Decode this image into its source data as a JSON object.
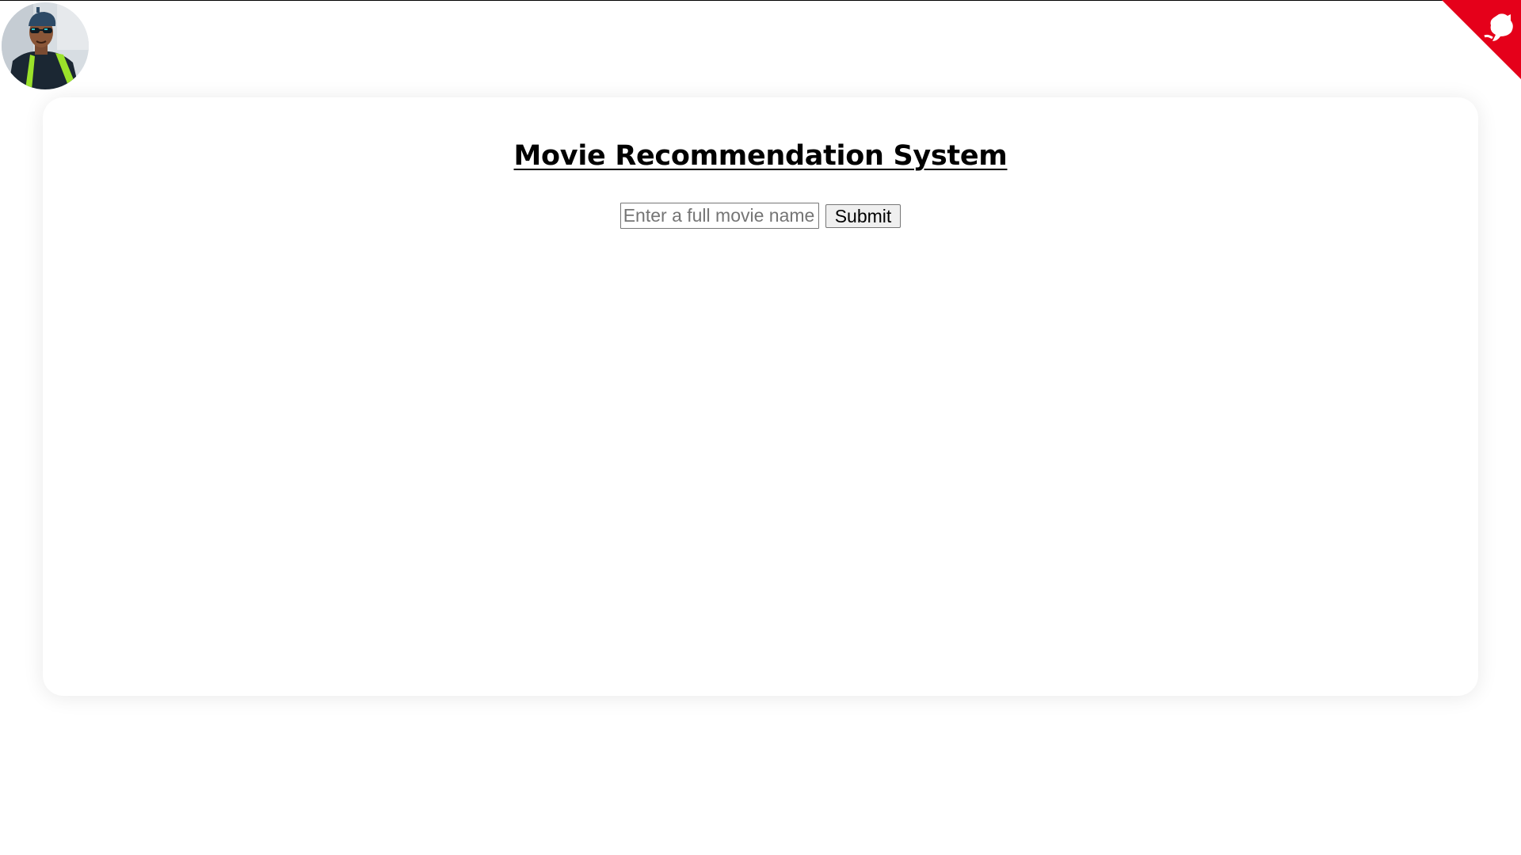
{
  "header": {
    "avatar_alt": "Profile photo",
    "corner_badge_icon": "github-octocat-icon"
  },
  "main": {
    "title": "Movie Recommendation System",
    "search": {
      "placeholder": "Enter a full movie name",
      "value": ""
    },
    "submit_label": "Submit"
  },
  "colors": {
    "corner_badge": "#e5001a",
    "page_background": "#ffffff",
    "button_background": "#efefef"
  }
}
